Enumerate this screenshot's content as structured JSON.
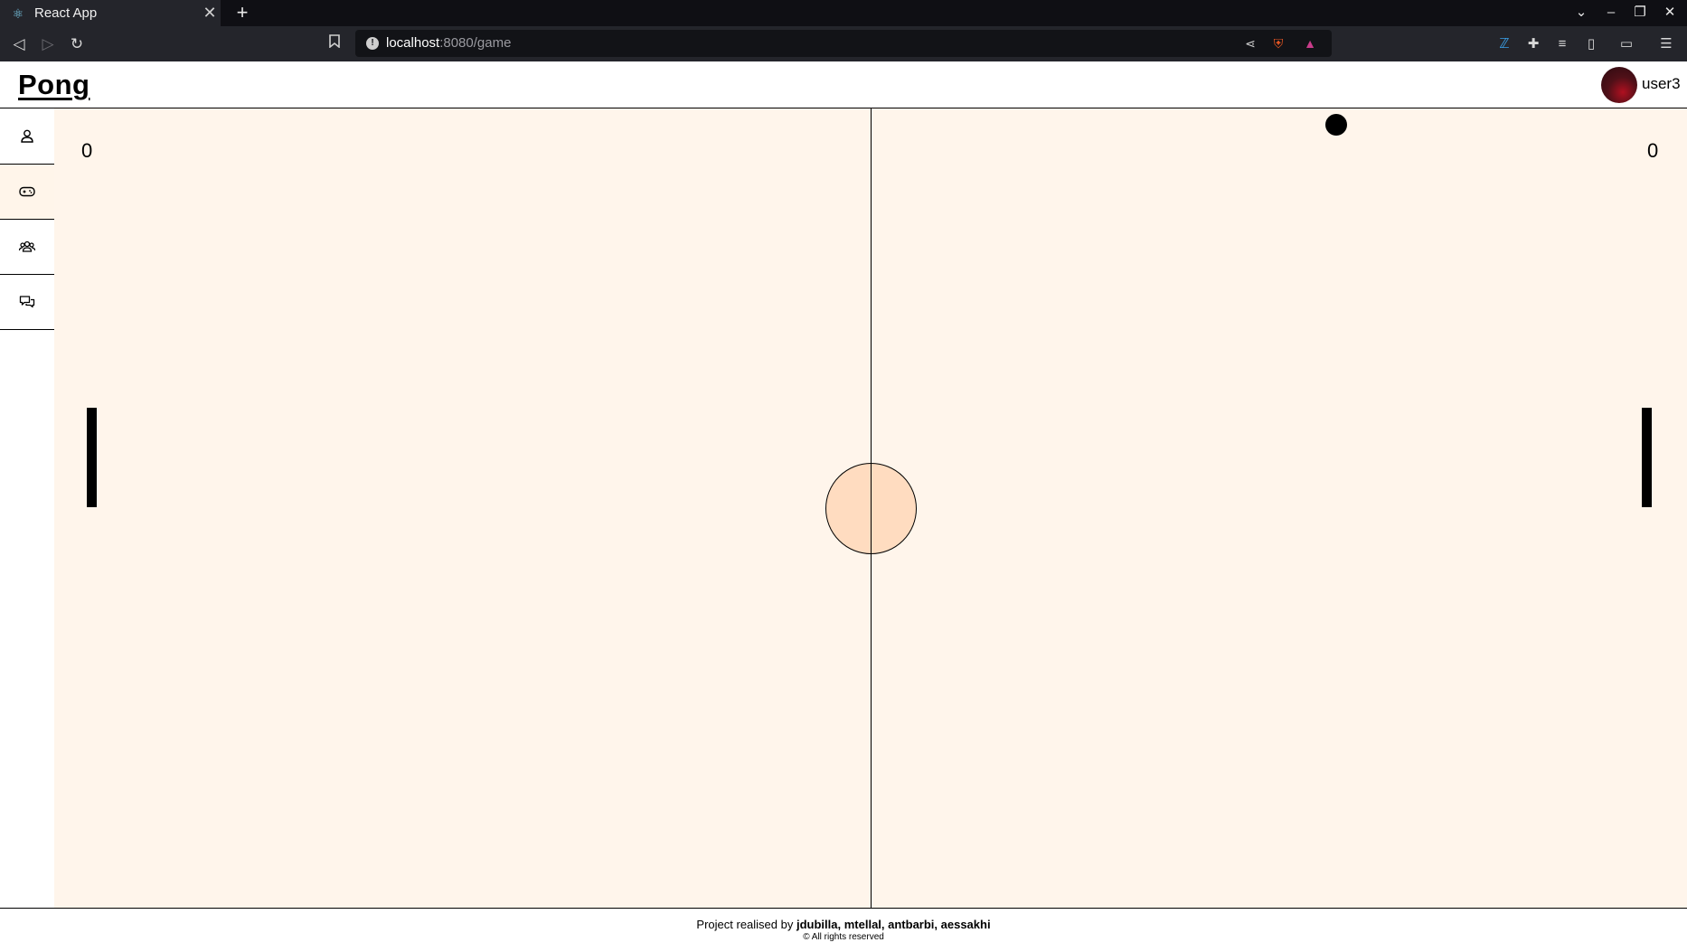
{
  "browser": {
    "tab_title": "React App",
    "tab_close": "✕",
    "new_tab": "+",
    "url_host": "localhost",
    "url_rest": ":8080/game",
    "info_glyph": "!",
    "icons": [
      "back-icon",
      "forward-icon",
      "reload-icon",
      "bookmark-icon",
      "share-icon",
      "brave-shields-icon",
      "brave-rewards-icon",
      "extension-icon",
      "puzzle-icon",
      "playlist-icon",
      "sidebar-icon",
      "wallet-icon",
      "menu-icon"
    ]
  },
  "app": {
    "logo": "Pong",
    "username": "user3"
  },
  "sidebar": {
    "items": [
      {
        "name": "profile",
        "icon": "user-icon",
        "active": false
      },
      {
        "name": "game",
        "icon": "gamepad-icon",
        "active": true
      },
      {
        "name": "friends",
        "icon": "users-icon",
        "active": false
      },
      {
        "name": "chat",
        "icon": "chat-icon",
        "active": false
      }
    ]
  },
  "game": {
    "score_left": "0",
    "score_right": "0",
    "colors": {
      "field": "#fff5eb",
      "center_circle": "#ffdcc0",
      "ball": "#000000",
      "paddle": "#000000"
    }
  },
  "footer": {
    "prefix": "Project realised by",
    "authors": "jdubilla, mtellal, antbarbi, aessakhi",
    "rights": "© All rights reserved"
  }
}
